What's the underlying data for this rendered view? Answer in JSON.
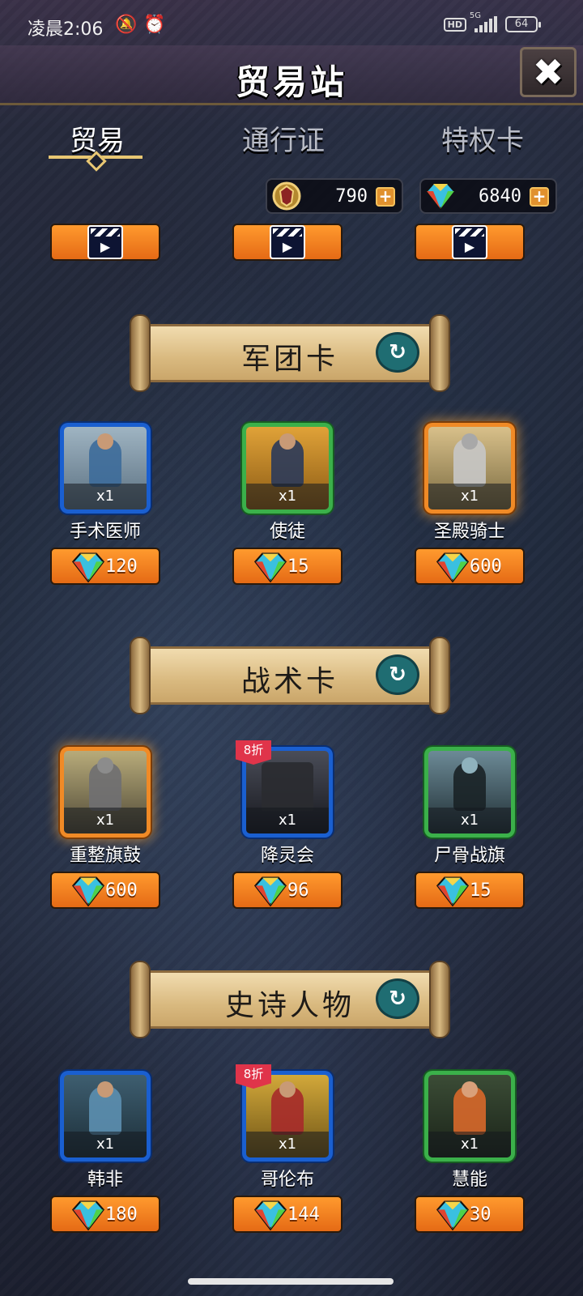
{
  "status_bar": {
    "time": "凌晨2:06",
    "network": "5G",
    "battery": "64"
  },
  "header": {
    "title": "贸易站"
  },
  "tabs": [
    {
      "label": "贸易",
      "active": true
    },
    {
      "label": "通行证",
      "active": false
    },
    {
      "label": "特权卡",
      "active": false
    }
  ],
  "currency": {
    "coin": {
      "value": "790"
    },
    "gem": {
      "value": "6840"
    }
  },
  "sections": [
    {
      "title": "军团卡",
      "cards": [
        {
          "name": "手术医师",
          "qty": "x1",
          "price": "120",
          "frame": "blue",
          "art": "#5a6f80"
        },
        {
          "name": "使徒",
          "qty": "x1",
          "price": "15",
          "frame": "green",
          "art": "#b0781a"
        },
        {
          "name": "圣殿骑士",
          "qty": "x1",
          "price": "600",
          "frame": "orange",
          "art": "#c5a66a"
        }
      ]
    },
    {
      "title": "战术卡",
      "cards": [
        {
          "name": "重整旗鼓",
          "qty": "x1",
          "price": "600",
          "frame": "orange",
          "art": "#8a7f5c"
        },
        {
          "name": "降灵会",
          "qty": "x1",
          "price": "96",
          "frame": "blue",
          "art": "#2a2c35",
          "discount": "8折"
        },
        {
          "name": "尸骨战旗",
          "qty": "x1",
          "price": "15",
          "frame": "green",
          "art": "#3c5a66"
        }
      ]
    },
    {
      "title": "史诗人物",
      "cards": [
        {
          "name": "韩非",
          "qty": "x1",
          "price": "180",
          "frame": "blue",
          "art": "#2e4a58"
        },
        {
          "name": "哥伦布",
          "qty": "x1",
          "price": "144",
          "frame": "blue",
          "art": "#b08a2a",
          "discount": "8折"
        },
        {
          "name": "慧能",
          "qty": "x1",
          "price": "30",
          "frame": "green",
          "art": "#2c3c2a"
        }
      ]
    }
  ],
  "icons": {
    "close": "close-icon",
    "refresh": "refresh-icon",
    "gem": "diamond-gem-icon",
    "coin": "crest-coin-icon",
    "video": "clapperboard-video-icon"
  }
}
